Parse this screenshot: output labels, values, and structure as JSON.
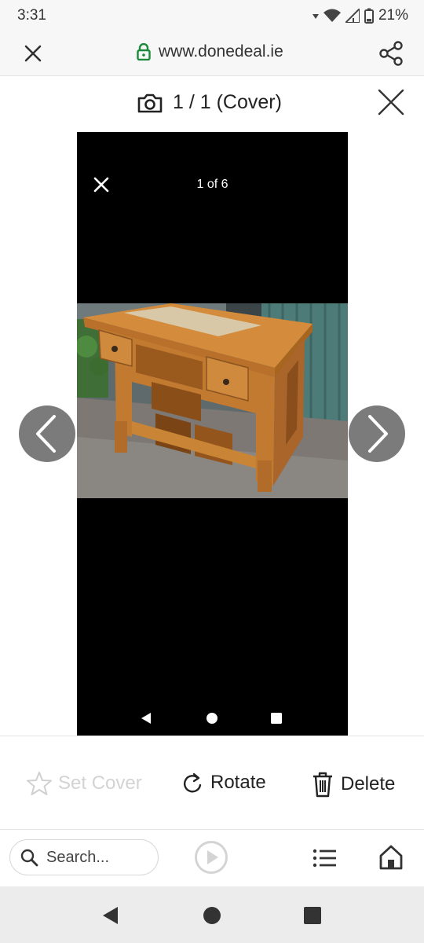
{
  "status": {
    "time": "3:31",
    "battery": "21%"
  },
  "url_bar": {
    "url": "www.donedeal.ie"
  },
  "header": {
    "title": "1 / 1 (Cover)"
  },
  "viewer": {
    "counter": "1 of 6"
  },
  "actions": {
    "set_cover": "Set Cover",
    "rotate": "Rotate",
    "delete": "Delete"
  },
  "browser": {
    "search_placeholder": "Search..."
  },
  "icons": [
    "camera-icon",
    "lock-icon",
    "share-icon",
    "close-icon",
    "chevron-left-icon",
    "chevron-right-icon",
    "star-icon",
    "rotate-icon",
    "trash-icon",
    "search-icon",
    "play-icon",
    "menu-icon",
    "home-icon"
  ],
  "colors": {
    "lock_green": "#1a8a3a",
    "viewer_bg": "#000000",
    "arrow_bg": "#7b7b7b",
    "disabled_text": "#d3d3d3"
  }
}
